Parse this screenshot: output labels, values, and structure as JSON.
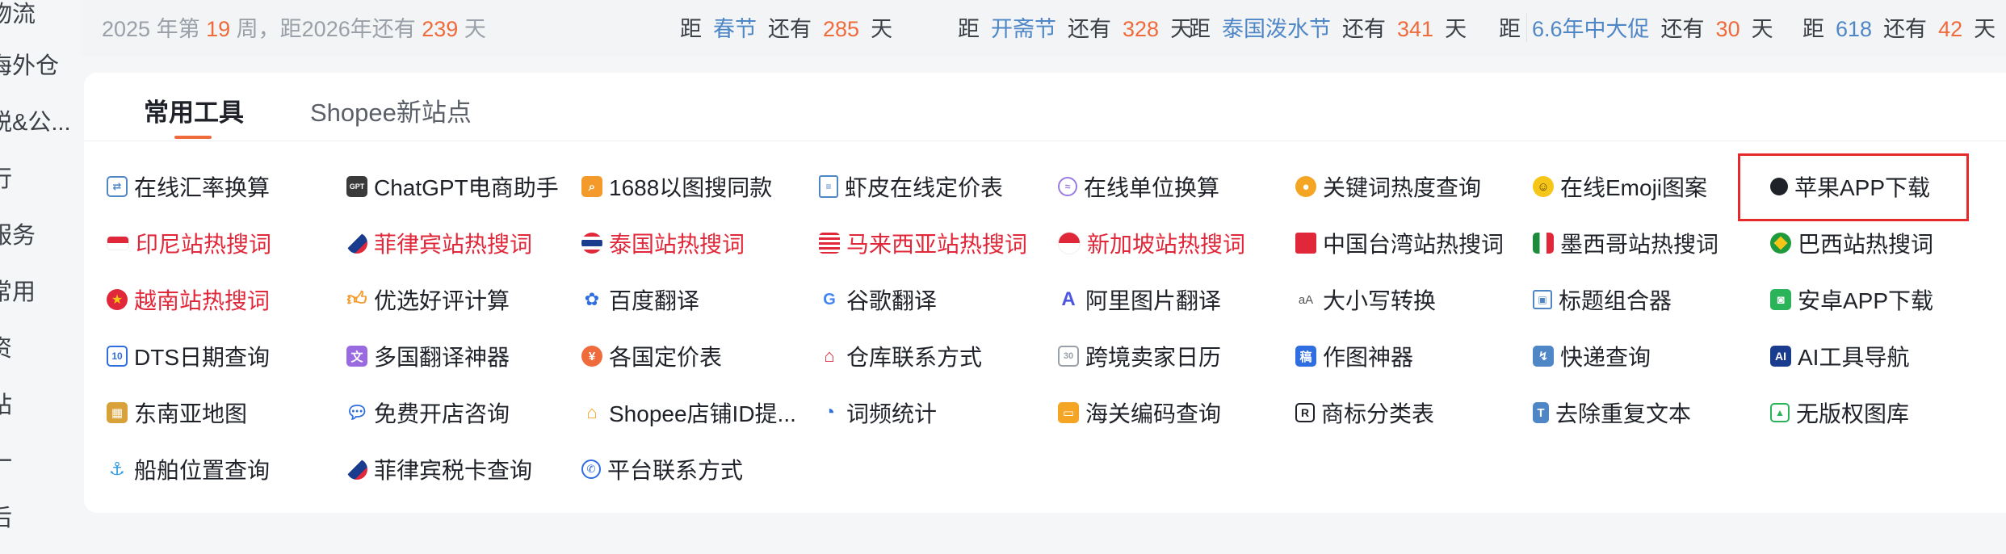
{
  "sidebar": {
    "items": [
      "物流",
      "海外仓",
      "税&公...",
      "行",
      "服务",
      "常用",
      "资",
      "站",
      "一",
      "后"
    ]
  },
  "topbar": {
    "year_prefix": "2025 年第",
    "week": "19",
    "year_mid": "周，距2026年还有",
    "days_to_new_year": "239",
    "day_unit": "天",
    "countdowns": [
      {
        "dist": "距",
        "event": "春节",
        "remain": "还有",
        "days": "285",
        "unit": "天"
      },
      {
        "dist": "距",
        "event": "开斋节",
        "remain": "还有",
        "days": "328",
        "unit": "天"
      },
      {
        "dist": "距",
        "event": "泰国泼水节",
        "remain": "还有",
        "days": "341",
        "unit": "天"
      },
      {
        "dist": "距",
        "event": "6.6年中大促",
        "remain": "还有",
        "days": "30",
        "unit": "天"
      },
      {
        "dist": "距",
        "event": "618",
        "remain": "还有",
        "days": "42",
        "unit": "天"
      }
    ]
  },
  "tabs": {
    "active": "常用工具",
    "inactive": "Shopee新站点"
  },
  "tools": [
    [
      "在线汇率换算",
      "ChatGPT电商助手",
      "1688以图搜同款",
      "虾皮在线定价表",
      "在线单位换算",
      "关键词热度查询",
      "在线Emoji图案",
      "苹果APP下载"
    ],
    [
      "印尼站热搜词",
      "菲律宾站热搜词",
      "泰国站热搜词",
      "马来西亚站热搜词",
      "新加坡站热搜词",
      "中国台湾站热搜词",
      "墨西哥站热搜词",
      "巴西站热搜词"
    ],
    [
      "越南站热搜词",
      "优选好评计算",
      "百度翻译",
      "谷歌翻译",
      "阿里图片翻译",
      "大小写转换",
      "标题组合器",
      "安卓APP下载"
    ],
    [
      "DTS日期查询",
      "多国翻译神器",
      "各国定价表",
      "仓库联系方式",
      "跨境卖家日历",
      "作图神器",
      "快递查询",
      "AI工具导航"
    ],
    [
      "东南亚地图",
      "免费开店咨询",
      "Shopee店铺ID提...",
      "词频统计",
      "海关编码查询",
      "商标分类表",
      "去除重复文本",
      "无版权图库"
    ],
    [
      "船舶位置查询",
      "菲律宾税卡查询",
      "平台联系方式"
    ]
  ],
  "icons": {
    "ChatGPT_icon_text": "GPT",
    "dts_icon_text": "10",
    "calendar_icon_text": "30",
    "ai_icon_text": "AI",
    "trademark_icon_text": "R",
    "google_icon_text": "G",
    "case_icon_text": "aA"
  },
  "colors": {
    "accent": "#ef6b3b",
    "link_blue": "#4f86c6",
    "hot_red": "#e0283a",
    "highlight_border": "#e52a2a"
  }
}
